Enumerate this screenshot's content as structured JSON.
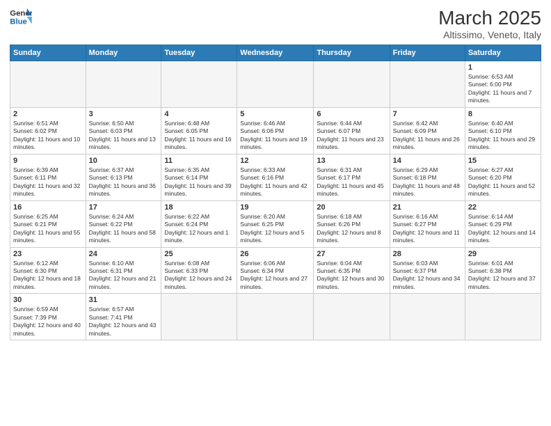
{
  "logo": {
    "text_general": "General",
    "text_blue": "Blue"
  },
  "title": "March 2025",
  "subtitle": "Altissimo, Veneto, Italy",
  "days_of_week": [
    "Sunday",
    "Monday",
    "Tuesday",
    "Wednesday",
    "Thursday",
    "Friday",
    "Saturday"
  ],
  "weeks": [
    [
      {
        "day": "",
        "info": ""
      },
      {
        "day": "",
        "info": ""
      },
      {
        "day": "",
        "info": ""
      },
      {
        "day": "",
        "info": ""
      },
      {
        "day": "",
        "info": ""
      },
      {
        "day": "",
        "info": ""
      },
      {
        "day": "1",
        "info": "Sunrise: 6:53 AM\nSunset: 6:00 PM\nDaylight: 11 hours and 7 minutes."
      }
    ],
    [
      {
        "day": "2",
        "info": "Sunrise: 6:51 AM\nSunset: 6:02 PM\nDaylight: 11 hours and 10 minutes."
      },
      {
        "day": "3",
        "info": "Sunrise: 6:50 AM\nSunset: 6:03 PM\nDaylight: 11 hours and 13 minutes."
      },
      {
        "day": "4",
        "info": "Sunrise: 6:48 AM\nSunset: 6:05 PM\nDaylight: 11 hours and 16 minutes."
      },
      {
        "day": "5",
        "info": "Sunrise: 6:46 AM\nSunset: 6:06 PM\nDaylight: 11 hours and 19 minutes."
      },
      {
        "day": "6",
        "info": "Sunrise: 6:44 AM\nSunset: 6:07 PM\nDaylight: 11 hours and 23 minutes."
      },
      {
        "day": "7",
        "info": "Sunrise: 6:42 AM\nSunset: 6:09 PM\nDaylight: 11 hours and 26 minutes."
      },
      {
        "day": "8",
        "info": "Sunrise: 6:40 AM\nSunset: 6:10 PM\nDaylight: 11 hours and 29 minutes."
      }
    ],
    [
      {
        "day": "9",
        "info": "Sunrise: 6:39 AM\nSunset: 6:11 PM\nDaylight: 11 hours and 32 minutes."
      },
      {
        "day": "10",
        "info": "Sunrise: 6:37 AM\nSunset: 6:13 PM\nDaylight: 11 hours and 36 minutes."
      },
      {
        "day": "11",
        "info": "Sunrise: 6:35 AM\nSunset: 6:14 PM\nDaylight: 11 hours and 39 minutes."
      },
      {
        "day": "12",
        "info": "Sunrise: 6:33 AM\nSunset: 6:16 PM\nDaylight: 11 hours and 42 minutes."
      },
      {
        "day": "13",
        "info": "Sunrise: 6:31 AM\nSunset: 6:17 PM\nDaylight: 11 hours and 45 minutes."
      },
      {
        "day": "14",
        "info": "Sunrise: 6:29 AM\nSunset: 6:18 PM\nDaylight: 11 hours and 48 minutes."
      },
      {
        "day": "15",
        "info": "Sunrise: 6:27 AM\nSunset: 6:20 PM\nDaylight: 11 hours and 52 minutes."
      }
    ],
    [
      {
        "day": "16",
        "info": "Sunrise: 6:25 AM\nSunset: 6:21 PM\nDaylight: 11 hours and 55 minutes."
      },
      {
        "day": "17",
        "info": "Sunrise: 6:24 AM\nSunset: 6:22 PM\nDaylight: 11 hours and 58 minutes."
      },
      {
        "day": "18",
        "info": "Sunrise: 6:22 AM\nSunset: 6:24 PM\nDaylight: 12 hours and 1 minute."
      },
      {
        "day": "19",
        "info": "Sunrise: 6:20 AM\nSunset: 6:25 PM\nDaylight: 12 hours and 5 minutes."
      },
      {
        "day": "20",
        "info": "Sunrise: 6:18 AM\nSunset: 6:26 PM\nDaylight: 12 hours and 8 minutes."
      },
      {
        "day": "21",
        "info": "Sunrise: 6:16 AM\nSunset: 6:27 PM\nDaylight: 12 hours and 11 minutes."
      },
      {
        "day": "22",
        "info": "Sunrise: 6:14 AM\nSunset: 6:29 PM\nDaylight: 12 hours and 14 minutes."
      }
    ],
    [
      {
        "day": "23",
        "info": "Sunrise: 6:12 AM\nSunset: 6:30 PM\nDaylight: 12 hours and 18 minutes."
      },
      {
        "day": "24",
        "info": "Sunrise: 6:10 AM\nSunset: 6:31 PM\nDaylight: 12 hours and 21 minutes."
      },
      {
        "day": "25",
        "info": "Sunrise: 6:08 AM\nSunset: 6:33 PM\nDaylight: 12 hours and 24 minutes."
      },
      {
        "day": "26",
        "info": "Sunrise: 6:06 AM\nSunset: 6:34 PM\nDaylight: 12 hours and 27 minutes."
      },
      {
        "day": "27",
        "info": "Sunrise: 6:04 AM\nSunset: 6:35 PM\nDaylight: 12 hours and 30 minutes."
      },
      {
        "day": "28",
        "info": "Sunrise: 6:03 AM\nSunset: 6:37 PM\nDaylight: 12 hours and 34 minutes."
      },
      {
        "day": "29",
        "info": "Sunrise: 6:01 AM\nSunset: 6:38 PM\nDaylight: 12 hours and 37 minutes."
      }
    ],
    [
      {
        "day": "30",
        "info": "Sunrise: 6:59 AM\nSunset: 7:39 PM\nDaylight: 12 hours and 40 minutes."
      },
      {
        "day": "31",
        "info": "Sunrise: 6:57 AM\nSunset: 7:41 PM\nDaylight: 12 hours and 43 minutes."
      },
      {
        "day": "",
        "info": ""
      },
      {
        "day": "",
        "info": ""
      },
      {
        "day": "",
        "info": ""
      },
      {
        "day": "",
        "info": ""
      },
      {
        "day": "",
        "info": ""
      }
    ]
  ]
}
